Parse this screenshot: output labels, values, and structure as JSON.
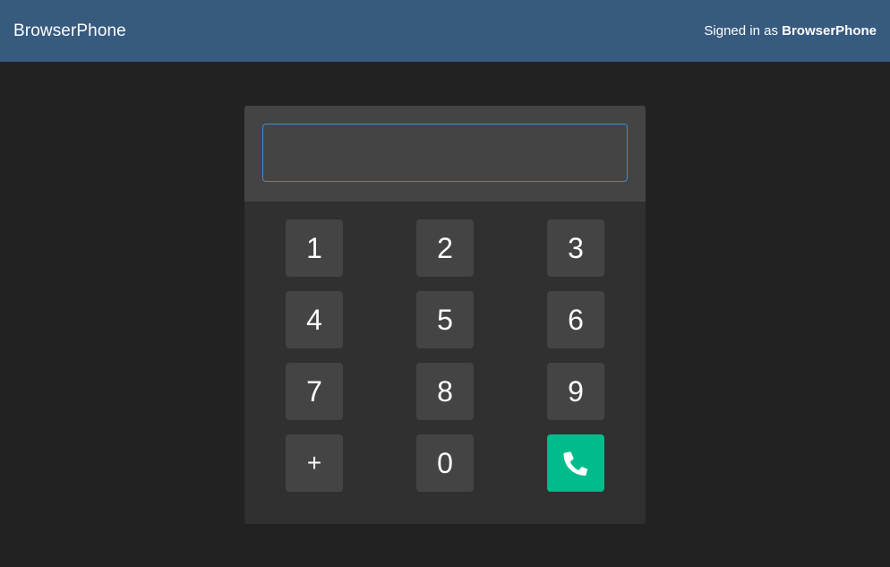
{
  "navbar": {
    "brand": "BrowserPhone",
    "signed_in_prefix": "Signed in as",
    "signed_in_user": "BrowserPhone"
  },
  "dialer": {
    "number_value": "",
    "number_placeholder": "",
    "keys": [
      "1",
      "2",
      "3",
      "4",
      "5",
      "6",
      "7",
      "8",
      "9",
      "+",
      "0"
    ],
    "call_icon": "phone-icon",
    "call_color": "#00bc8c"
  },
  "colors": {
    "navbar": "#375a7f",
    "background": "#222222",
    "panel": "#303030",
    "key": "#444444",
    "input_border": "#3a8cd6"
  }
}
